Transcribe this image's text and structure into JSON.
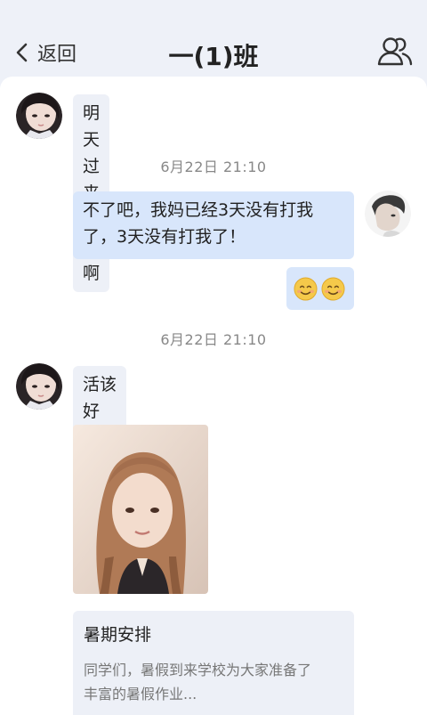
{
  "header": {
    "back_label": "返回",
    "title": "一(1)班",
    "members_icon": "group-icon"
  },
  "messages": [
    {
      "type": "text",
      "direction": "in",
      "text": "明天过来吃饭啊"
    },
    {
      "type": "timestamp",
      "text": "6月22日   21:10"
    },
    {
      "type": "text",
      "direction": "out",
      "text_line1": "不了吧，我妈已经3天没有打我",
      "text_line2": "了，3天没有打我了！"
    },
    {
      "type": "emoji",
      "direction": "out",
      "emojis": [
        "😊",
        "😊"
      ]
    },
    {
      "type": "timestamp",
      "text": "6月22日   21:10"
    },
    {
      "type": "text",
      "direction": "in",
      "text": "活该好吧！"
    },
    {
      "type": "image",
      "direction": "in",
      "alt": "girl-portrait-photo"
    },
    {
      "type": "card",
      "direction": "in",
      "title": "暑期安排",
      "body_line1": "同学们，暑假到来学校为大家准备了",
      "body_line2": "丰富的暑假作业..."
    }
  ],
  "colors": {
    "background": "#eef1f8",
    "incoming_bubble": "#edf0f7",
    "outgoing_bubble": "#d8e6fb",
    "timestamp_text": "#888888"
  }
}
